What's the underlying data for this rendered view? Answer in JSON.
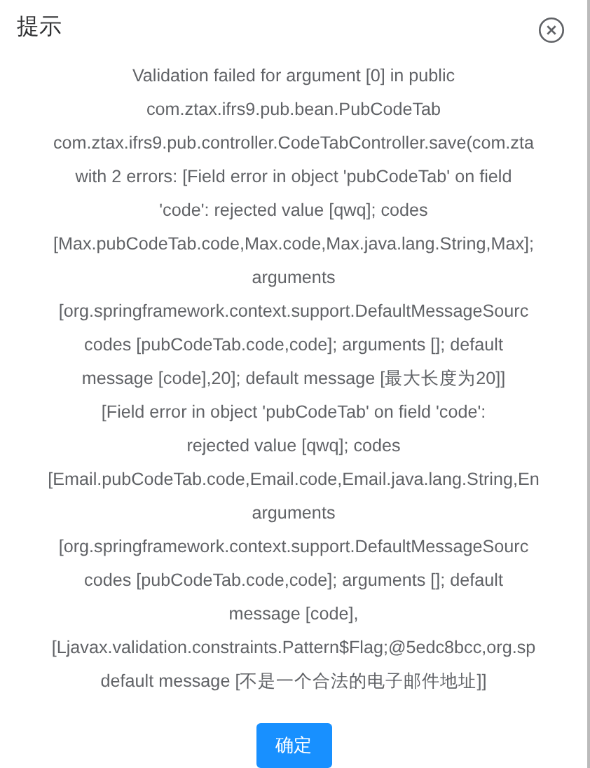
{
  "dialog": {
    "title": "提示",
    "message_lines": [
      "Validation failed for argument [0] in public",
      "com.ztax.ifrs9.pub.bean.PubCodeTab",
      "com.ztax.ifrs9.pub.controller.CodeTabController.save(com.zta",
      "with 2 errors: [Field error in object 'pubCodeTab' on field",
      "'code': rejected value [qwq]; codes",
      "[Max.pubCodeTab.code,Max.code,Max.java.lang.String,Max];",
      "arguments",
      "[org.springframework.context.support.DefaultMessageSourc",
      "codes [pubCodeTab.code,code]; arguments []; default",
      "message [code],20]; default message [最大长度为20]]",
      "[Field error in object 'pubCodeTab' on field 'code':",
      "rejected value [qwq]; codes",
      "[Email.pubCodeTab.code,Email.code,Email.java.lang.String,En",
      "arguments",
      "[org.springframework.context.support.DefaultMessageSourc",
      "codes [pubCodeTab.code,code]; arguments []; default",
      "message [code],",
      "[Ljavax.validation.constraints.Pattern$Flag;@5edc8bcc,org.sp",
      "default message [不是一个合法的电子邮件地址]]"
    ],
    "confirm_button": "确定"
  }
}
